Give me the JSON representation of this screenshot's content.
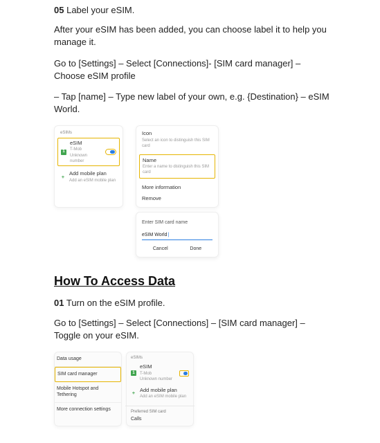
{
  "s05": {
    "num": "05",
    "title": "Label your eSIM."
  },
  "p1": "After your eSIM has been added, you can choose label it to help you manage it.",
  "p2": "Go to [Settings] – Select [Connections]- [SIM card manager] – Choose eSIM profile",
  "p3": "– Tap [name] – Type new label of your own, e.g. {Destination} – eSIM World.",
  "img1": {
    "left": {
      "tab": "eSIMs",
      "esim": "eSIM",
      "esim_sub1": "T-Mob",
      "esim_sub2": "Unknown number",
      "add": "Add mobile plan",
      "add_sub": "Add an eSIM mobile plan"
    },
    "right": {
      "icon_head": "Icon",
      "icon_sub": "Select an icon to distinguish this SIM card",
      "name_head": "Name",
      "name_sub": "Enter a name to distinguish this SIM card",
      "more": "More information",
      "remove": "Remove"
    },
    "dialog": {
      "title": "Enter SIM card name",
      "value": "eSIM World",
      "cancel": "Cancel",
      "done": "Done"
    }
  },
  "h2": "How To Access Data",
  "s01": {
    "num": "01",
    "title": "Turn on the eSIM profile."
  },
  "p4": "Go to [Settings] – Select [Connections] – [SIM card manager] – Toggle on your eSIM.",
  "img2": {
    "left": {
      "a": "Data usage",
      "b": "SIM card manager",
      "c": "Mobile Hotspot and Tethering",
      "d": "More connection settings"
    },
    "right": {
      "tab": "eSIMs",
      "esim": "eSIM",
      "esim_sub1": "T-Mob",
      "esim_sub2": "Unknown number",
      "add": "Add mobile plan",
      "add_sub": "Add an eSIM mobile plan",
      "pref": "Preferred SIM card",
      "calls": "Calls"
    }
  }
}
